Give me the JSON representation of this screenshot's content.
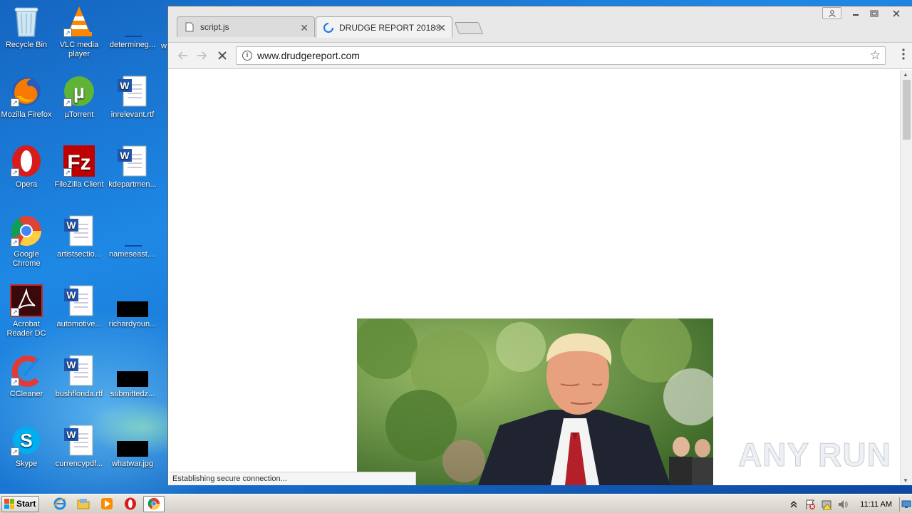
{
  "desktop": {
    "icons": [
      {
        "label": "Recycle Bin"
      },
      {
        "label": "VLC media player"
      },
      {
        "label": "determineg..."
      },
      {
        "label": "w"
      },
      {
        "label": "Mozilla Firefox"
      },
      {
        "label": "µTorrent"
      },
      {
        "label": "inrelevant.rtf"
      },
      {
        "label": "Opera"
      },
      {
        "label": "FileZilla Client"
      },
      {
        "label": "kdepartmen..."
      },
      {
        "label": "Google Chrome"
      },
      {
        "label": "artistsectio..."
      },
      {
        "label": "nameseast...."
      },
      {
        "label": "Acrobat Reader DC"
      },
      {
        "label": "automotive..."
      },
      {
        "label": "richardyoun..."
      },
      {
        "label": "CCleaner"
      },
      {
        "label": "bushflorida.rtf"
      },
      {
        "label": "submittedz..."
      },
      {
        "label": "Skype"
      },
      {
        "label": "currencypdf..."
      },
      {
        "label": "whatwar.jpg"
      }
    ]
  },
  "browser": {
    "tabs": [
      {
        "title": "script.js",
        "close": "✕"
      },
      {
        "title": "DRUDGE REPORT 2018®",
        "close": "✕"
      }
    ],
    "url": "www.drudgereport.com",
    "status": "Establishing secure connection..."
  },
  "watermark": {
    "left": "ANY",
    "right": "RUN"
  },
  "taskbar": {
    "start_label": "Start",
    "clock": "11:11 AM"
  }
}
